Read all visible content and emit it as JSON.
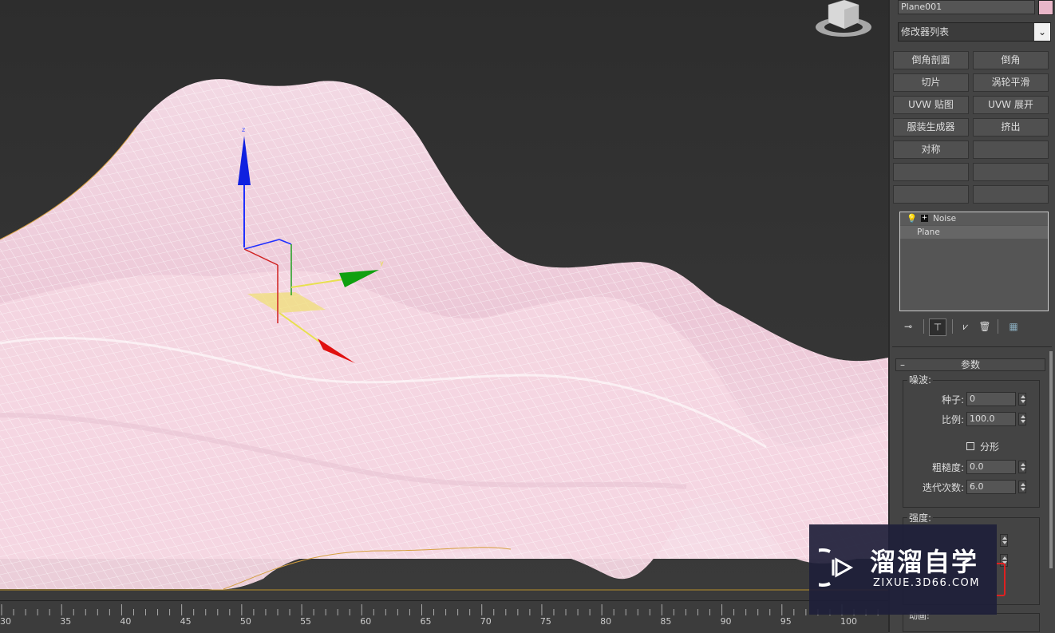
{
  "object_name": "Plane001",
  "object_color": "#e8b6c8",
  "modifier_list": "修改器列表",
  "modifier_buttons": [
    "倒角剖面",
    "倒角",
    "切片",
    "涡轮平滑",
    "UVW 贴图",
    "UVW 展开",
    "服装生成器",
    "挤出",
    "对称",
    "",
    "",
    "",
    "",
    ""
  ],
  "stack": [
    "Noise",
    "Plane"
  ],
  "parameters": {
    "rollout_title": "参数",
    "noise_group": "噪波:",
    "seed_label": "种子:",
    "seed_value": "0",
    "scale_label": "比例:",
    "scale_value": "100.0",
    "fractal_label": "分形",
    "roughness_label": "粗糙度:",
    "roughness_value": "0.0",
    "iterations_label": "迭代次数:",
    "iterations_value": "6.0",
    "strength_group": "强度:",
    "animation_group": "动画:"
  },
  "gizmo_labels": {
    "z": "z",
    "y": "y"
  },
  "timeline_ticks": [
    "30",
    "35",
    "40",
    "45",
    "50",
    "55",
    "60",
    "65",
    "70",
    "75",
    "80",
    "85",
    "90",
    "95",
    "100"
  ],
  "watermark": {
    "brand": "溜溜自学",
    "url": "ZIXUE.3D66.COM"
  },
  "colors": {
    "mesh_fill": "#f2d3e0",
    "wire": "#ffffff",
    "highlight": "#e8b6c8",
    "accent_red": "#e02020"
  }
}
